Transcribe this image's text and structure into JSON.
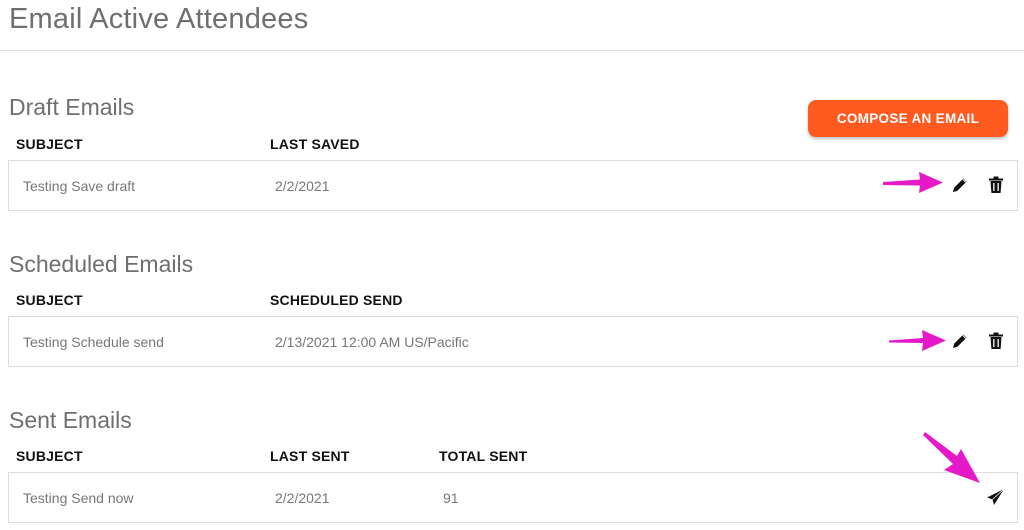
{
  "page": {
    "title": "Email Active Attendees"
  },
  "compose_button": {
    "label": "COMPOSE AN EMAIL",
    "color": "#ff5a1f"
  },
  "drafts": {
    "title": "Draft Emails",
    "headers": {
      "subject": "SUBJECT",
      "date": "LAST SAVED"
    },
    "rows": [
      {
        "subject": "Testing Save draft",
        "date": "2/2/2021"
      }
    ]
  },
  "scheduled": {
    "title": "Scheduled Emails",
    "headers": {
      "subject": "SUBJECT",
      "date": "SCHEDULED SEND"
    },
    "rows": [
      {
        "subject": "Testing Schedule send",
        "date": "2/13/2021 12:00 AM US/Pacific"
      }
    ]
  },
  "sent": {
    "title": "Sent Emails",
    "headers": {
      "subject": "SUBJECT",
      "date": "LAST SENT",
      "total": "TOTAL SENT"
    },
    "rows": [
      {
        "subject": "Testing Send now",
        "date": "2/2/2021",
        "total": "91"
      }
    ]
  },
  "icons": {
    "edit": "pencil-icon",
    "delete": "trash-icon",
    "send": "paper-plane-icon",
    "annotation": "magenta-arrow-icon"
  },
  "colors": {
    "annotation": "#e619c8",
    "accent": "#ff5a1f"
  }
}
